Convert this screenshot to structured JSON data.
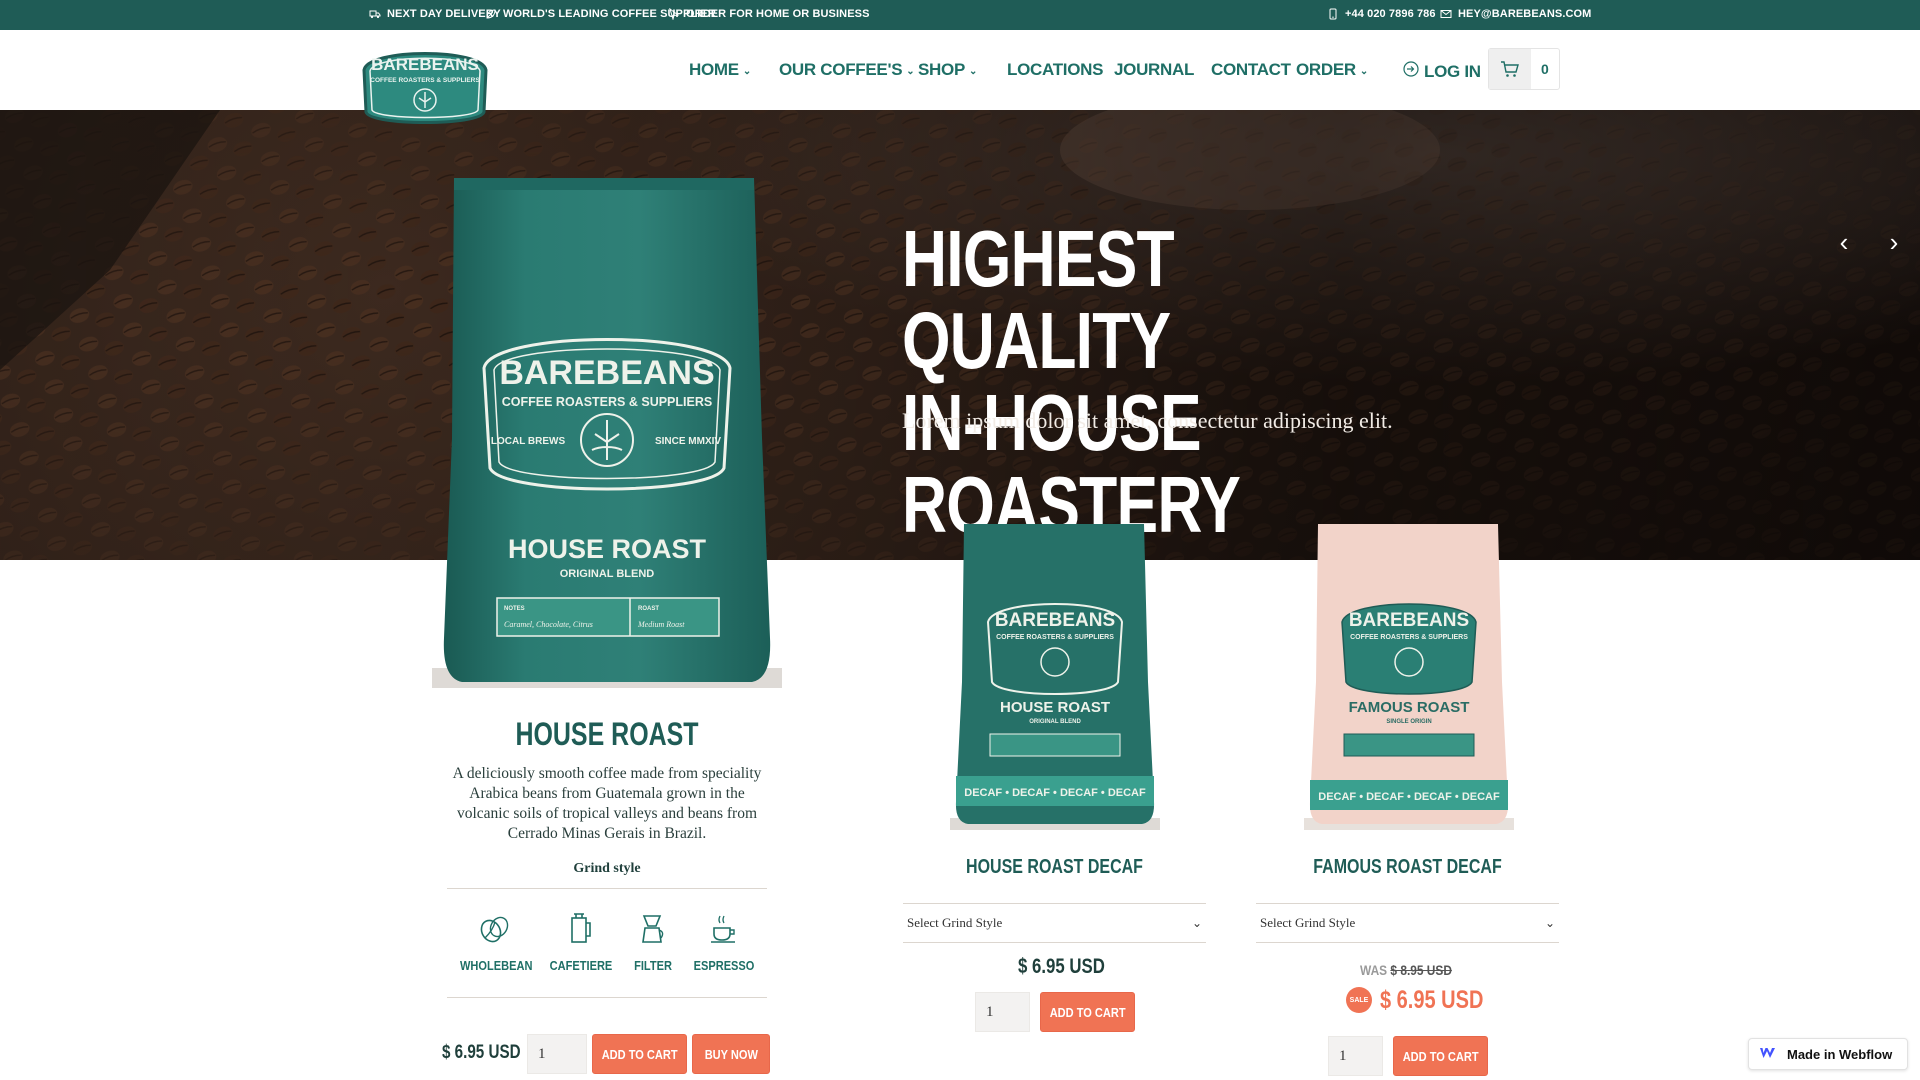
{
  "topbar": {
    "left": [
      {
        "icon": "truck-icon",
        "label": "NEXT DAY DELIVERY"
      },
      {
        "icon": "leaf-icon",
        "label": "WORLD'S LEADING COFFEE SUPPLIER"
      },
      {
        "icon": "pointer-icon",
        "label": "ORDER FOR HOME OR BUSINESS"
      }
    ],
    "right": [
      {
        "icon": "phone-icon",
        "label": "+44 020 7896 786"
      },
      {
        "icon": "mail-icon",
        "label": "HEY@BAREBEANS.COM"
      }
    ]
  },
  "logo": {
    "text": "BAREBEANS",
    "tagline": "COFFEE ROASTERS & SUPPLIERS"
  },
  "nav": {
    "items": [
      {
        "label": "HOME",
        "dropdown": true
      },
      {
        "label": "OUR COFFEE'S",
        "dropdown": true
      },
      {
        "label": "SHOP",
        "dropdown": true
      },
      {
        "label": "LOCATIONS",
        "dropdown": false
      },
      {
        "label": "JOURNAL",
        "dropdown": false
      },
      {
        "label": "CONTACT",
        "dropdown": false
      },
      {
        "label": "ORDER",
        "dropdown": true
      }
    ],
    "login": "LOG IN",
    "cart_count": "0"
  },
  "hero": {
    "line1": "HIGHEST QUALITY",
    "line2": "IN-HOUSE ROASTERY",
    "subtitle": "Lorem ipsum dolor sit amet, consectetur adipiscing elit."
  },
  "featured": {
    "name": "HOUSE ROAST",
    "bag": {
      "brand": "BAREBEANS",
      "tagline": "COFFEE ROASTERS & SUPPLIERS",
      "badge_left": "LOCAL BREWS",
      "badge_right": "SINCE MMXIV",
      "title": "HOUSE ROAST",
      "subtitle": "ORIGINAL BLEND",
      "notes_label": "NOTES",
      "notes_value": "Caramel, Chocolate, Citrus",
      "roast_label": "ROAST",
      "roast_value": "Medium Roast"
    },
    "description": "A deliciously smooth coffee made from speciality Arabica beans from Guatemala grown in the volcanic soils of tropical valleys and beans from Cerrado Minas Gerais in Brazil.",
    "grind_title": "Grind style",
    "grind_options": [
      "WHOLEBEAN",
      "CAFETIERE",
      "FILTER",
      "ESPRESSO"
    ],
    "price": "$ 6.95 USD",
    "qty": "1",
    "add_to_cart": "ADD TO CART",
    "buy_now": "BUY NOW"
  },
  "products": [
    {
      "name": "HOUSE ROAST DECAF",
      "bag_title": "HOUSE ROAST",
      "bag_subtitle": "ORIGINAL BLEND",
      "bag_band": "DECAF • DECAF • DECAF • DECAF",
      "select_placeholder": "Select Grind Style",
      "price": "$ 6.95 USD",
      "qty": "1",
      "add_to_cart": "ADD TO CART"
    },
    {
      "name": "FAMOUS ROAST DECAF",
      "bag_title": "FAMOUS ROAST",
      "bag_subtitle": "SINGLE ORIGIN",
      "bag_band": "DECAF • DECAF • DECAF • DECAF",
      "select_placeholder": "Select Grind Style",
      "was_label": "WAS",
      "was_price": "$ 8.95 USD",
      "sale_badge": "SALE",
      "price": "$ 6.95 USD",
      "qty": "1",
      "add_to_cart": "ADD TO CART"
    }
  ],
  "badge": {
    "label": "Made in Webflow"
  },
  "colors": {
    "brand_teal": "#1f5c56",
    "accent_orange": "#f07354",
    "pink_bag": "#f2d3c9"
  }
}
